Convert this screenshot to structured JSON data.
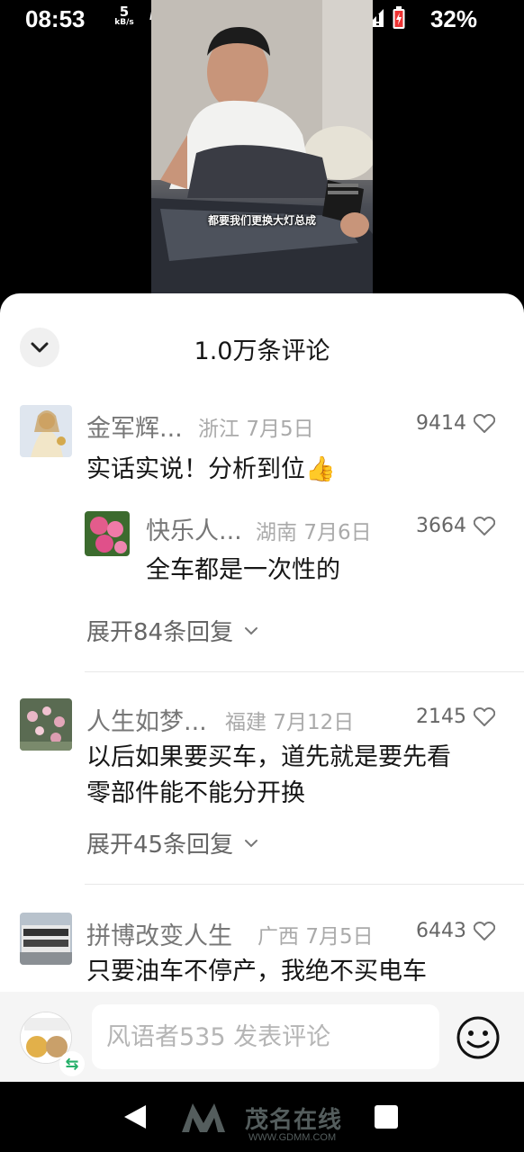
{
  "status_bar": {
    "time": "08:53",
    "net_speed_value": "5",
    "net_speed_unit": "kB/s",
    "hd_label": "HD",
    "battery_percent": "32%"
  },
  "video": {
    "caption": "都要我们更换大灯总成"
  },
  "comments_sheet": {
    "title": "1.0万条评论",
    "comments": [
      {
        "name": "金军辉...",
        "location": "浙江",
        "date": "7月5日",
        "likes": "9414",
        "text": "实话实说！分析到位👍",
        "reply": {
          "name": "快乐人...",
          "location": "湖南",
          "date": "7月6日",
          "likes": "3664",
          "text": "全车都是一次性的"
        },
        "expand_label": "展开84条回复"
      },
      {
        "name": "人生如梦...",
        "location": "福建",
        "date": "7月12日",
        "likes": "2145",
        "text_line1": "以后如果要买车，道先就是要先看",
        "text_line2": "零部件能不能分开换",
        "expand_label": "展开45条回复"
      },
      {
        "name": "拼博改变人生",
        "location": "广西",
        "date": "7月5日",
        "likes": "6443",
        "text": "只要油车不停产，我绝不买电车"
      }
    ]
  },
  "input_bar": {
    "placeholder": "风语者535 发表评论"
  },
  "watermark": {
    "title": "茂名在线",
    "url": "WWW.GDMM.COM"
  },
  "colors": {
    "accent_green": "#26b06a",
    "text_primary": "#161616",
    "text_secondary": "#777777"
  }
}
